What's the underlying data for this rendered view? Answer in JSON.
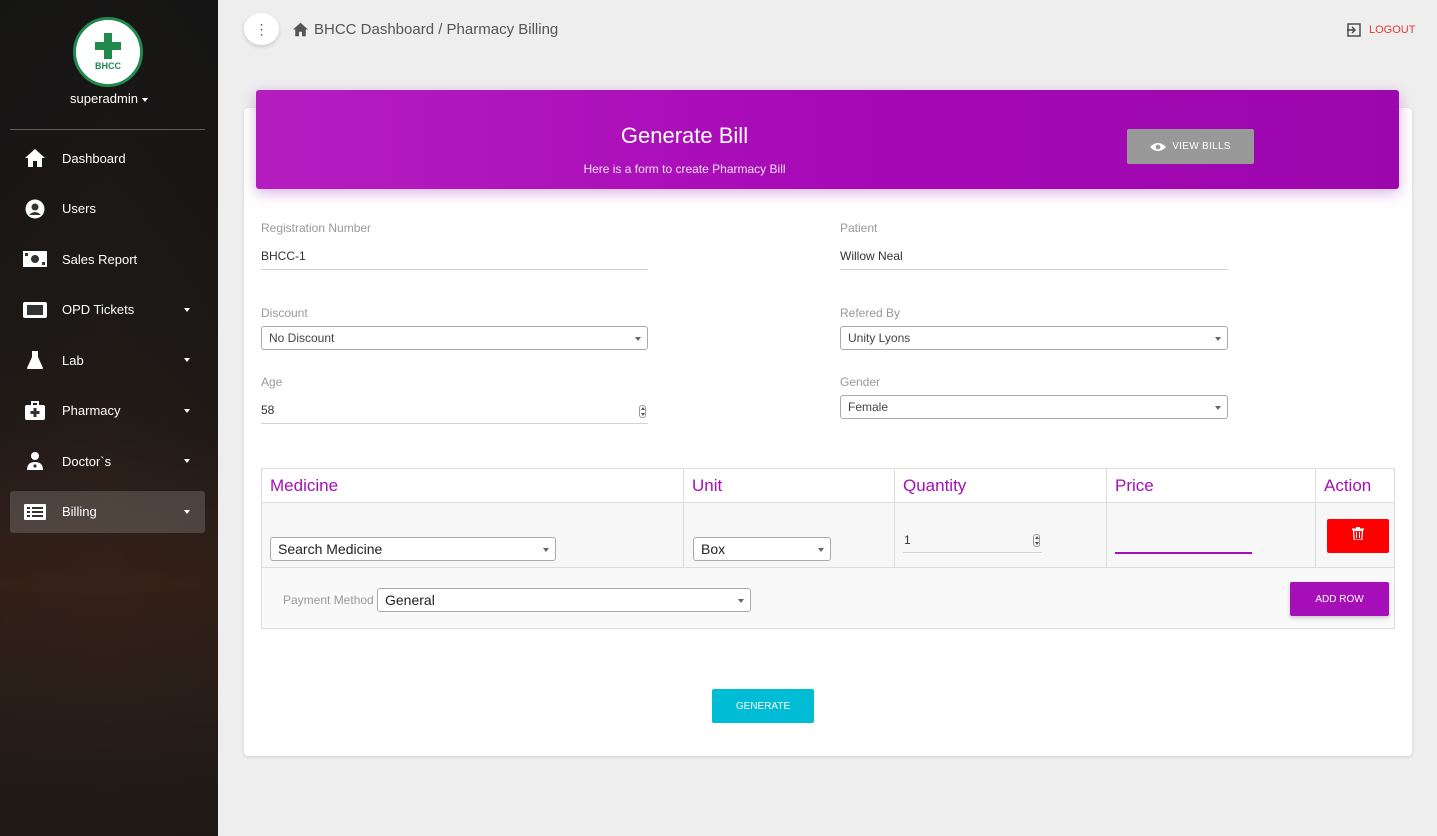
{
  "sidebar": {
    "logo_text": "BHCC",
    "user": "superadmin",
    "items": [
      {
        "label": "Dashboard",
        "icon": "home-icon",
        "has_caret": false
      },
      {
        "label": "Users",
        "icon": "user-circle-icon",
        "has_caret": false
      },
      {
        "label": "Sales Report",
        "icon": "money-icon",
        "has_caret": false
      },
      {
        "label": "OPD Tickets",
        "icon": "ticket-icon",
        "has_caret": true
      },
      {
        "label": "Lab",
        "icon": "flask-icon",
        "has_caret": true
      },
      {
        "label": "Pharmacy",
        "icon": "medkit-icon",
        "has_caret": true
      },
      {
        "label": "Doctor`s",
        "icon": "doctor-icon",
        "has_caret": true
      },
      {
        "label": "Billing",
        "icon": "list-icon",
        "has_caret": true,
        "active": true
      }
    ]
  },
  "topbar": {
    "breadcrumb": "BHCC Dashboard / Pharmacy Billing",
    "logout": "LOGOUT"
  },
  "header": {
    "title": "Generate Bill",
    "subtitle": "Here is a form to create Pharmacy Bill",
    "view_bills": "VIEW BILLS"
  },
  "form": {
    "registration": {
      "label": "Registration Number",
      "value": "BHCC-1"
    },
    "patient": {
      "label": "Patient",
      "value": "Willow Neal"
    },
    "discount": {
      "label": "Discount",
      "value": "No Discount"
    },
    "referred_by": {
      "label": "Refered By",
      "value": "Unity Lyons"
    },
    "age": {
      "label": "Age",
      "value": "58"
    },
    "gender": {
      "label": "Gender",
      "value": "Female"
    }
  },
  "table": {
    "headers": [
      "Medicine",
      "Unit",
      "Quantity",
      "Price",
      "Action"
    ],
    "row": {
      "medicine": "Search Medicine",
      "unit": "Box",
      "quantity": "1",
      "price": ""
    },
    "payment_label": "Payment Method",
    "payment_value": "General",
    "add_row": "ADD ROW"
  },
  "generate": "GENERATE",
  "colors": {
    "accent": "#a60fb8",
    "danger": "#ff0000",
    "generate": "#00bcd4"
  }
}
